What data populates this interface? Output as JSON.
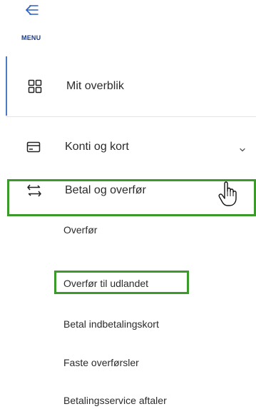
{
  "menu": {
    "label": "MENU",
    "toggle_icon": "back-arrow-lines-icon"
  },
  "nav": {
    "items": [
      {
        "label": "Mit overblik",
        "icon": "grid-icon",
        "active": true
      },
      {
        "label": "Konti og kort",
        "icon": "card-icon",
        "expandable": true
      },
      {
        "label": "Betal og overfør",
        "icon": "transfer-arrows-icon",
        "expanded": true
      }
    ],
    "sub_items": [
      {
        "label": "Overfør"
      },
      {
        "label": "Overfør til udlandet"
      },
      {
        "label": "Betal indbetalingskort"
      },
      {
        "label": "Faste overførsler"
      },
      {
        "label": "Betalingsservice aftaler"
      }
    ]
  },
  "colors": {
    "highlight": "#3a9a2a",
    "active_indicator": "#4a7bc8",
    "menu_label": "#1a3a8a"
  }
}
